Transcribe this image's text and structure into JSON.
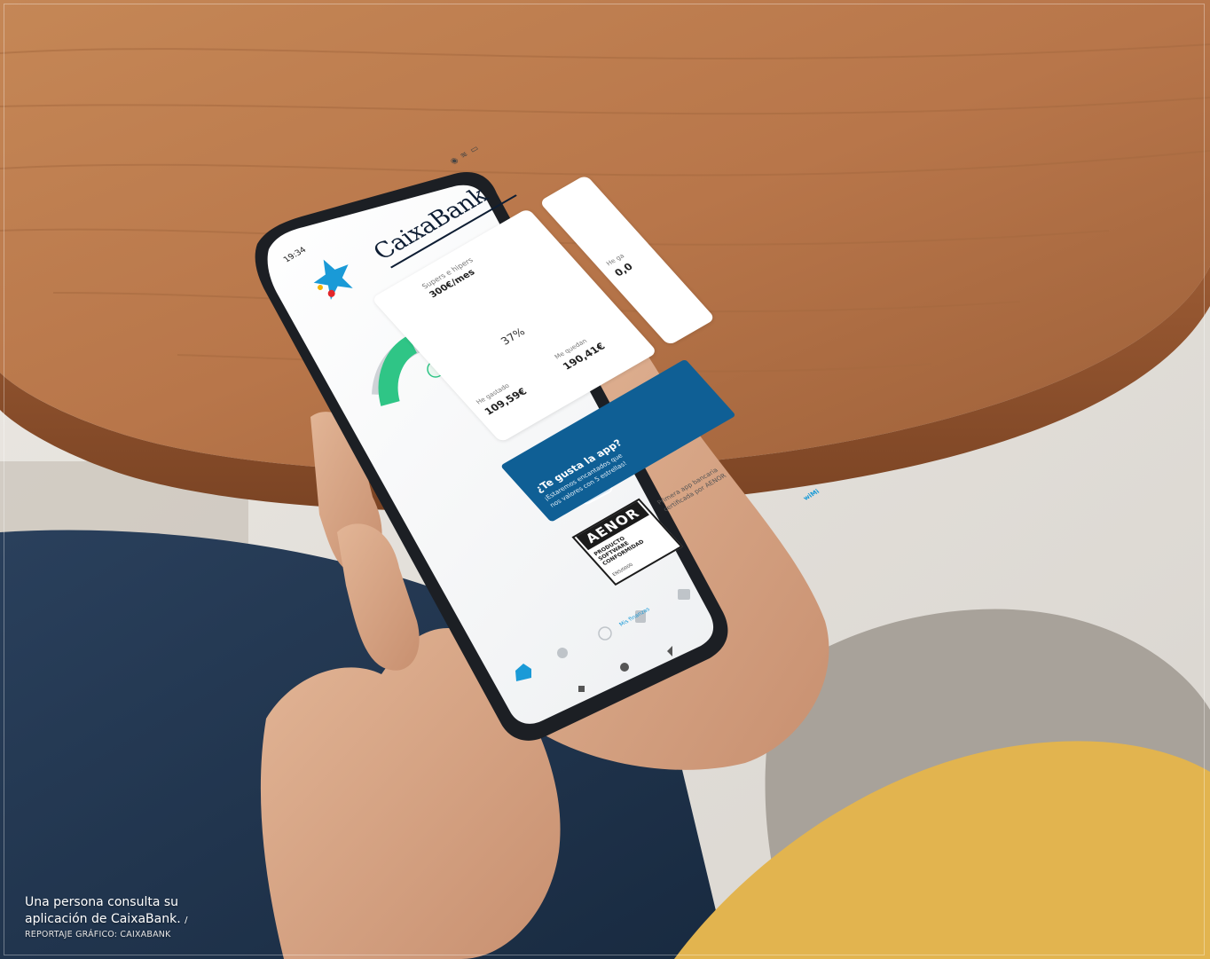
{
  "photo": {
    "scene": "phone-in-hands-over-wooden-table",
    "colors": {
      "wood": "#b8764a",
      "wood_dark": "#8c5430",
      "wall": "#e9e6e1",
      "jeans": "#22364f",
      "sweater": "#a8a29a",
      "sleeve_yellow": "#e2b44f",
      "skin": "#d7a585",
      "phone_body": "#1c1f24",
      "accent_green": "#2fc586",
      "accent_blue": "#0f5f95",
      "brand_blue": "#1a9ad7"
    }
  },
  "caption": {
    "line1": "Una persona consulta su",
    "line2": "aplicación de CaixaBank.",
    "credit_separator": "/",
    "credit": "REPORTAJE GRÁFICO: CAIXABANK"
  },
  "phone_screen": {
    "status_time": "19:34",
    "status_icons": "◉ ≋ ▭",
    "brand_name": "CaixaBank",
    "logo_icon": "caixabank-star-icon",
    "budget_card": {
      "label": "Supers e hipers",
      "budget": "300€/mes",
      "percent_text": "37%",
      "percent": 37,
      "spent_label": "He gastado",
      "spent_value": "109,59€",
      "left_label": "Me quedan",
      "left_value": "190,41€"
    },
    "second_card": {
      "label": "He ga",
      "value": "0,0"
    },
    "rate_banner": {
      "title": "¿Te gusta la app?",
      "line1": "¡Estaremos encantados que",
      "line2": "nos valores con 5 estrellas!"
    },
    "aenor": {
      "title": "AENOR",
      "line1": "PRODUCTO",
      "line2": "SOFTWARE",
      "line3": "CONFORMIDAD",
      "line4": "ENS/0000",
      "cert_line1": "Primera app bancaria",
      "cert_line2": "certificada por AENOR"
    },
    "nav": {
      "home_label": "Mis finanzas",
      "home_icon": "home-icon",
      "more_label": "wiMi"
    }
  }
}
